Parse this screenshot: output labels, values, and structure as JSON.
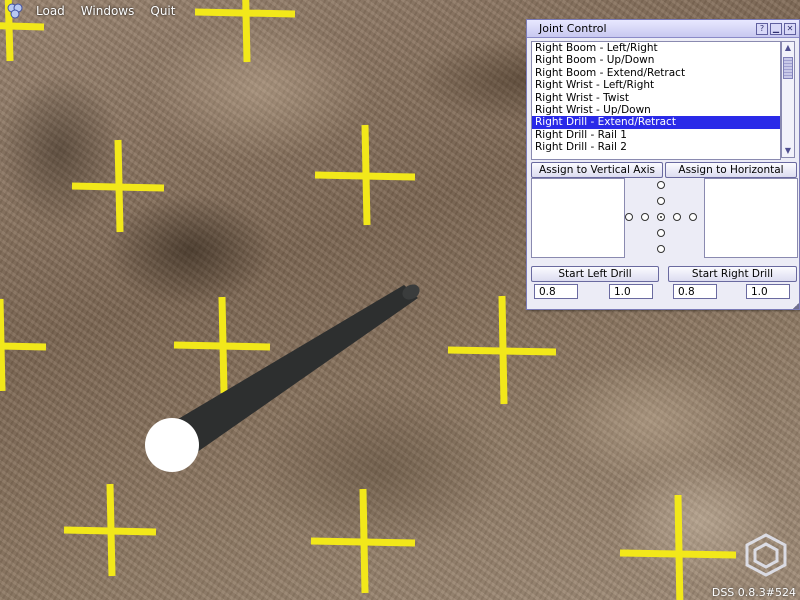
{
  "menubar": {
    "items": [
      {
        "label": "Load"
      },
      {
        "label": "Windows"
      },
      {
        "label": "Quit"
      }
    ]
  },
  "scene": {
    "marker_color": "#f2e81a",
    "drill_color": "#2d2f2f"
  },
  "joint_control": {
    "title": "Joint Control",
    "joints": [
      {
        "label": "Right Boom - Left/Right"
      },
      {
        "label": "Right Boom - Up/Down"
      },
      {
        "label": "Right Boom - Extend/Retract"
      },
      {
        "label": "Right Wrist - Left/Right"
      },
      {
        "label": "Right Wrist - Twist"
      },
      {
        "label": "Right Wrist - Up/Down"
      },
      {
        "label": "Right Drill - Extend/Retract",
        "selected": true
      },
      {
        "label": "Right Drill - Rail 1"
      },
      {
        "label": "Right Drill - Rail 2"
      }
    ],
    "assign_vertical_label": "Assign to Vertical Axis",
    "assign_horizontal_label": "Assign to Horizontal Axis",
    "start_left_drill_label": "Start Left Drill",
    "start_right_drill_label": "Start Right Drill",
    "left_drill_values": [
      "0.8",
      "1.0"
    ],
    "right_drill_values": [
      "0.8",
      "1.0"
    ]
  },
  "version": "DSS 0.8.3#524"
}
